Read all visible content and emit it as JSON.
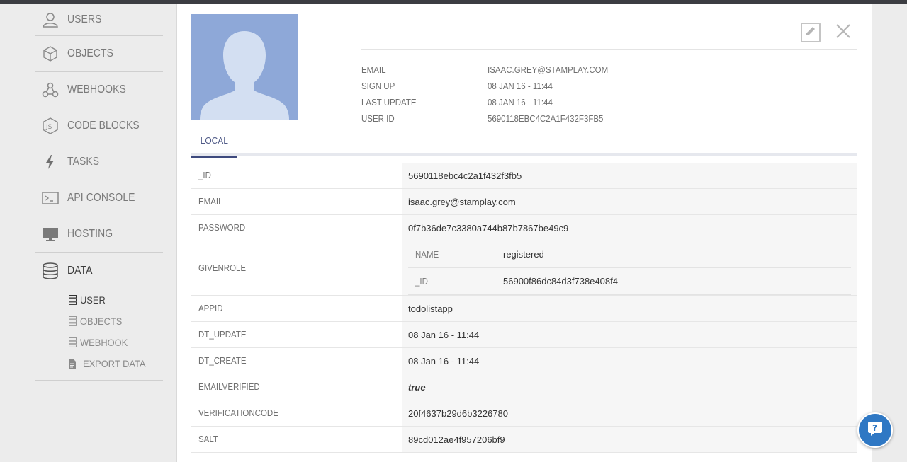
{
  "sidebar": {
    "items": [
      {
        "label": "USERS",
        "icon": "user-icon"
      },
      {
        "label": "OBJECTS",
        "icon": "cube-icon"
      },
      {
        "label": "WEBHOOKS",
        "icon": "webhook-icon"
      },
      {
        "label": "CODE BLOCKS",
        "icon": "nodejs-icon"
      },
      {
        "label": "TASKS",
        "icon": "lightning-icon"
      },
      {
        "label": "API CONSOLE",
        "icon": "terminal-icon"
      },
      {
        "label": "HOSTING",
        "icon": "monitor-icon"
      },
      {
        "label": "DATA",
        "icon": "database-icon"
      }
    ],
    "data_sub": [
      {
        "label": "USER",
        "icon": "list-icon"
      },
      {
        "label": "OBJECTS",
        "icon": "list-icon"
      },
      {
        "label": "WEBHOOK",
        "icon": "list-icon"
      },
      {
        "label": "EXPORT DATA",
        "icon": "file-icon"
      }
    ]
  },
  "profile": {
    "meta": [
      {
        "key": "EMAIL",
        "value": "ISAAC.GREY@STAMPLAY.COM"
      },
      {
        "key": "SIGN UP",
        "value": "08 JAN 16 - 11:44"
      },
      {
        "key": "LAST UPDATE",
        "value": "08 JAN 16 - 11:44"
      },
      {
        "key": "USER ID",
        "value": "5690118EBC4C2A1F432F3FB5"
      }
    ],
    "tab": "LOCAL"
  },
  "fields": [
    {
      "key": "_ID",
      "value": "5690118ebc4c2a1f432f3fb5"
    },
    {
      "key": "EMAIL",
      "value": "isaac.grey@stamplay.com"
    },
    {
      "key": "PASSWORD",
      "value": "0f7b36de7c3380a744b87b7867be49c9"
    },
    {
      "key": "GIVENROLE",
      "nested": [
        {
          "key": "NAME",
          "value": "registered"
        },
        {
          "key": "_ID",
          "value": "56900f86dc84d3f738e408f4"
        }
      ]
    },
    {
      "key": "APPID",
      "value": "todolistapp"
    },
    {
      "key": "DT_UPDATE",
      "value": "08 Jan 16 - 11:44"
    },
    {
      "key": "DT_CREATE",
      "value": "08 Jan 16 - 11:44"
    },
    {
      "key": "EMAILVERIFIED",
      "value": "true"
    },
    {
      "key": "VERIFICATIONCODE",
      "value": "20f4637b29d6b3226780"
    },
    {
      "key": "SALT",
      "value": "89cd012ae4f957206bf9"
    }
  ],
  "colors": {
    "accent": "#3e4a7e",
    "avatar_bg": "#8ea8d8",
    "help_button": "#2f78c4"
  }
}
